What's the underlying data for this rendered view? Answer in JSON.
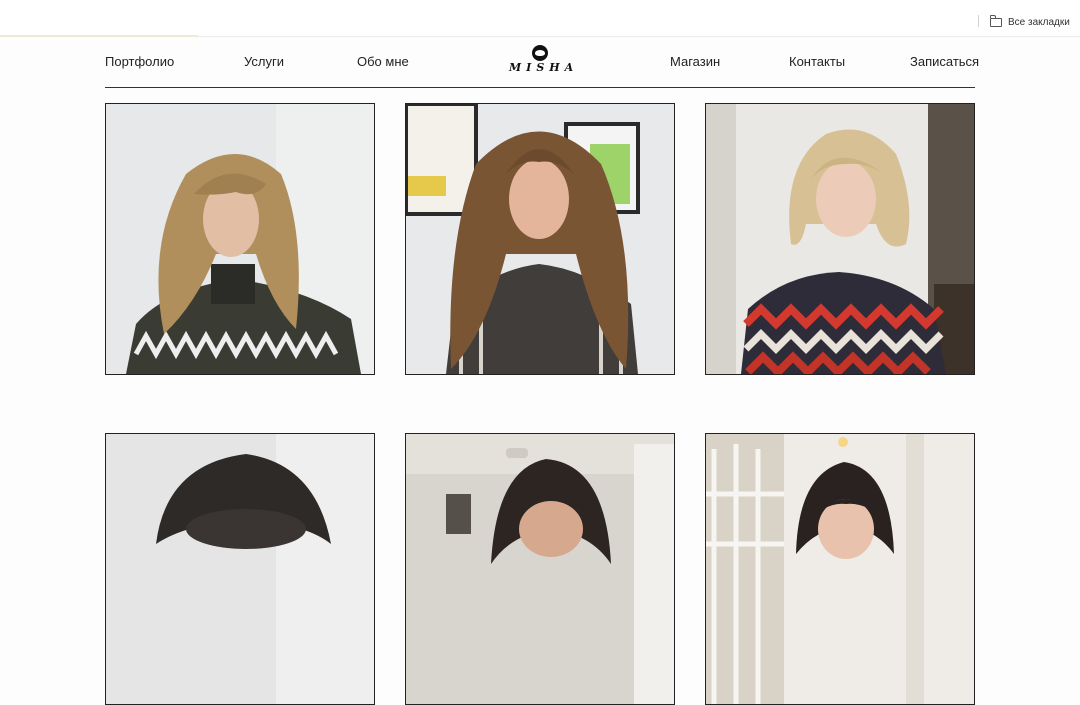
{
  "browser": {
    "bookmarks_bar": {
      "all_bookmarks_label": "Все закладки"
    }
  },
  "site": {
    "logo_text": "MISHA",
    "nav": {
      "left": [
        "Портфолио",
        "Услуги",
        "Обо мне"
      ],
      "right": [
        "Магазин",
        "Контакты",
        "Записаться"
      ]
    }
  },
  "gallery": {
    "items": [
      {
        "hair": "wavy-blonde-bangs",
        "top": "dark-patterned-sweater"
      },
      {
        "hair": "long-brunette-waves",
        "top": "striped-top"
      },
      {
        "hair": "blonde-bob",
        "top": "red-zigzag-sweater"
      },
      {
        "hair": "dark-brunette",
        "top": "unknown"
      },
      {
        "hair": "dark-wavy",
        "top": "unknown"
      },
      {
        "hair": "dark-shag-bangs",
        "top": "unknown"
      }
    ]
  }
}
